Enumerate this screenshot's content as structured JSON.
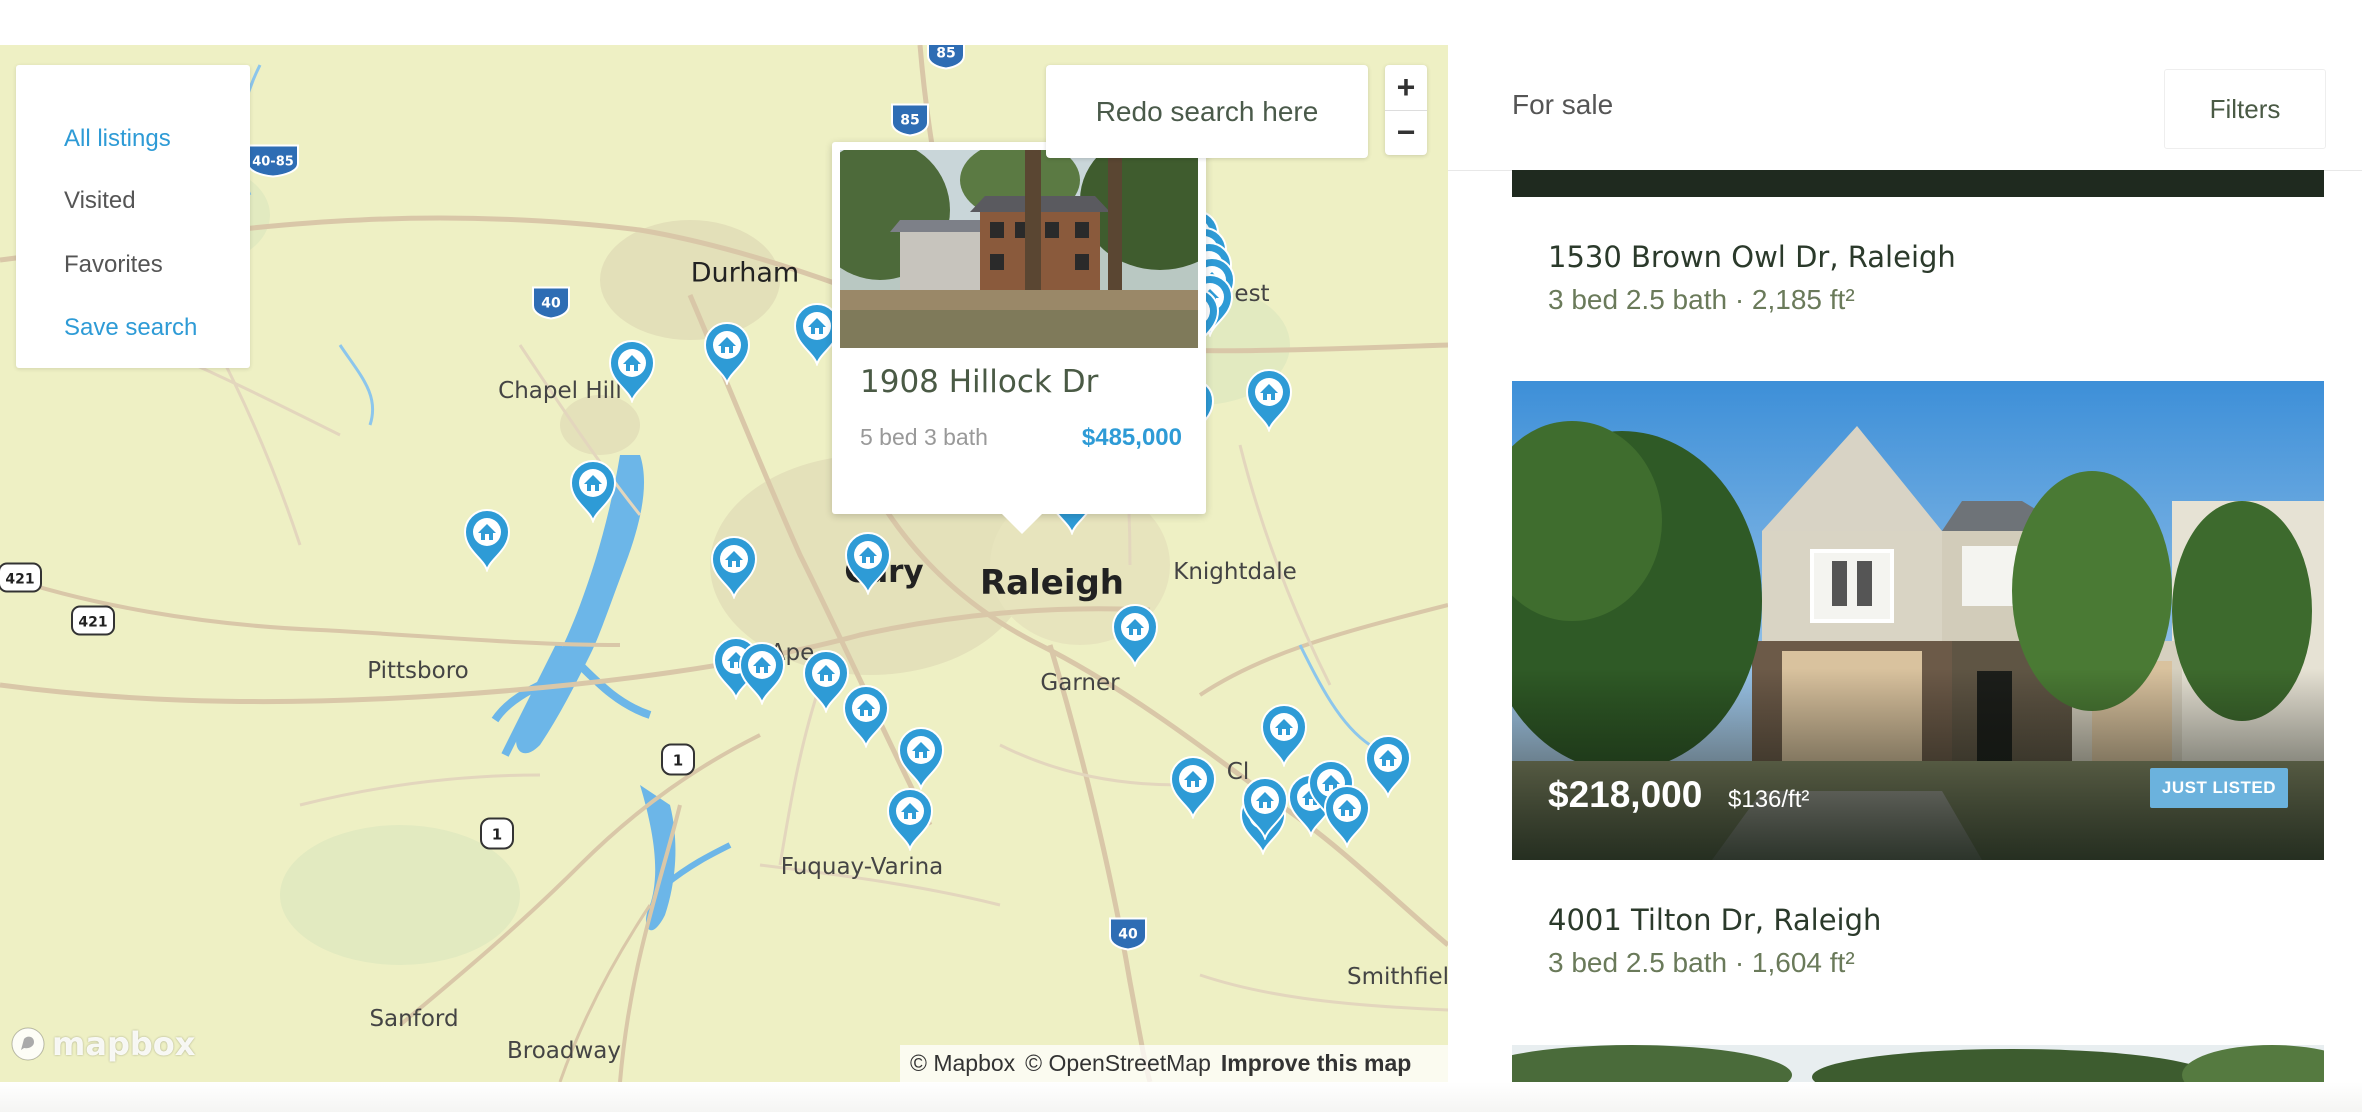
{
  "map": {
    "nav": {
      "all_listings": "All listings",
      "visited": "Visited",
      "favorites": "Favorites",
      "save_search": "Save search"
    },
    "redo_search": "Redo search here",
    "zoom_in": "+",
    "zoom_out": "−",
    "cities": {
      "durham": "Durham",
      "chapel_hill": "Chapel Hill",
      "cary": "Cary",
      "raleigh": "Raleigh",
      "knightdale": "Knightdale",
      "pittsboro": "Pittsboro",
      "apex": "Ape",
      "garner": "Garner",
      "fuquay": "Fuquay-Varina",
      "smithfield": "Smithfiel",
      "sanford": "Sanford",
      "broadway": "Broadway",
      "clayton": "Cl",
      "wake_forest": "est"
    },
    "shields": {
      "i85_top": "85",
      "i85": "85",
      "i40_85": "40-85",
      "i40_west": "40",
      "us421_left": "421",
      "us421": "421",
      "us1_a": "1",
      "us1_b": "1",
      "i40_south": "40"
    },
    "popup": {
      "address": "1908 Hillock Dr",
      "beds_baths": "5 bed 3 bath",
      "price": "$485,000"
    },
    "attribution": {
      "mapbox": "© Mapbox",
      "osm": "© OpenStreetMap",
      "improve": "Improve this map"
    },
    "logo": "mapbox"
  },
  "panel": {
    "title": "For sale",
    "filters": "Filters",
    "listings": [
      {
        "address": "1530 Brown Owl Dr, Raleigh",
        "meta": "3 bed 2.5 bath · 2,185 ft²"
      },
      {
        "price": "$218,000",
        "price_per_sqft": "$136/ft²",
        "badge": "JUST LISTED",
        "address": "4001 Tilton Dr, Raleigh",
        "meta": "3 bed 2.5 bath · 1,604 ft²"
      }
    ]
  },
  "colors": {
    "accent": "#2e9bd6",
    "map_land": "#eef0c4",
    "water": "#6cb6e8",
    "dark_green": "#1f2a1f"
  }
}
